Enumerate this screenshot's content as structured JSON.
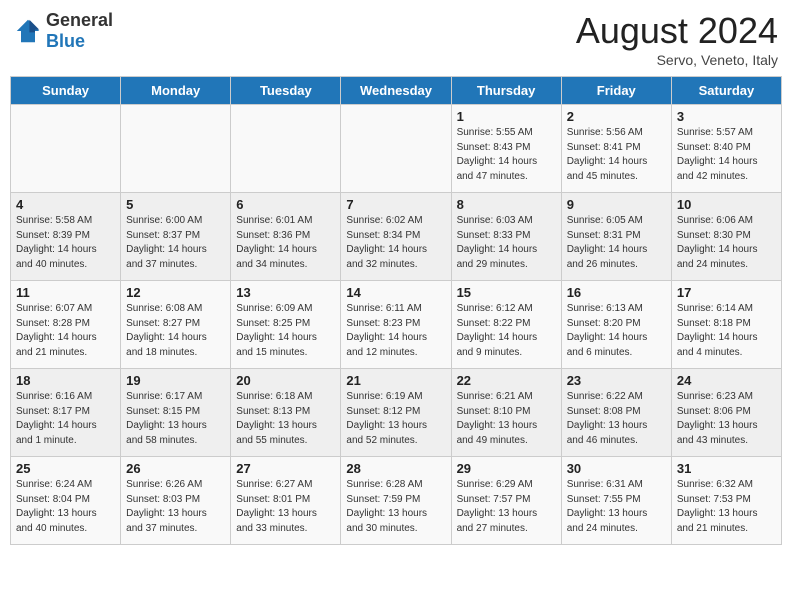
{
  "header": {
    "logo_general": "General",
    "logo_blue": "Blue",
    "month_year": "August 2024",
    "location": "Servo, Veneto, Italy"
  },
  "days_of_week": [
    "Sunday",
    "Monday",
    "Tuesday",
    "Wednesday",
    "Thursday",
    "Friday",
    "Saturday"
  ],
  "weeks": [
    [
      {
        "day": "",
        "info": ""
      },
      {
        "day": "",
        "info": ""
      },
      {
        "day": "",
        "info": ""
      },
      {
        "day": "",
        "info": ""
      },
      {
        "day": "1",
        "info": "Sunrise: 5:55 AM\nSunset: 8:43 PM\nDaylight: 14 hours and 47 minutes."
      },
      {
        "day": "2",
        "info": "Sunrise: 5:56 AM\nSunset: 8:41 PM\nDaylight: 14 hours and 45 minutes."
      },
      {
        "day": "3",
        "info": "Sunrise: 5:57 AM\nSunset: 8:40 PM\nDaylight: 14 hours and 42 minutes."
      }
    ],
    [
      {
        "day": "4",
        "info": "Sunrise: 5:58 AM\nSunset: 8:39 PM\nDaylight: 14 hours and 40 minutes."
      },
      {
        "day": "5",
        "info": "Sunrise: 6:00 AM\nSunset: 8:37 PM\nDaylight: 14 hours and 37 minutes."
      },
      {
        "day": "6",
        "info": "Sunrise: 6:01 AM\nSunset: 8:36 PM\nDaylight: 14 hours and 34 minutes."
      },
      {
        "day": "7",
        "info": "Sunrise: 6:02 AM\nSunset: 8:34 PM\nDaylight: 14 hours and 32 minutes."
      },
      {
        "day": "8",
        "info": "Sunrise: 6:03 AM\nSunset: 8:33 PM\nDaylight: 14 hours and 29 minutes."
      },
      {
        "day": "9",
        "info": "Sunrise: 6:05 AM\nSunset: 8:31 PM\nDaylight: 14 hours and 26 minutes."
      },
      {
        "day": "10",
        "info": "Sunrise: 6:06 AM\nSunset: 8:30 PM\nDaylight: 14 hours and 24 minutes."
      }
    ],
    [
      {
        "day": "11",
        "info": "Sunrise: 6:07 AM\nSunset: 8:28 PM\nDaylight: 14 hours and 21 minutes."
      },
      {
        "day": "12",
        "info": "Sunrise: 6:08 AM\nSunset: 8:27 PM\nDaylight: 14 hours and 18 minutes."
      },
      {
        "day": "13",
        "info": "Sunrise: 6:09 AM\nSunset: 8:25 PM\nDaylight: 14 hours and 15 minutes."
      },
      {
        "day": "14",
        "info": "Sunrise: 6:11 AM\nSunset: 8:23 PM\nDaylight: 14 hours and 12 minutes."
      },
      {
        "day": "15",
        "info": "Sunrise: 6:12 AM\nSunset: 8:22 PM\nDaylight: 14 hours and 9 minutes."
      },
      {
        "day": "16",
        "info": "Sunrise: 6:13 AM\nSunset: 8:20 PM\nDaylight: 14 hours and 6 minutes."
      },
      {
        "day": "17",
        "info": "Sunrise: 6:14 AM\nSunset: 8:18 PM\nDaylight: 14 hours and 4 minutes."
      }
    ],
    [
      {
        "day": "18",
        "info": "Sunrise: 6:16 AM\nSunset: 8:17 PM\nDaylight: 14 hours and 1 minute."
      },
      {
        "day": "19",
        "info": "Sunrise: 6:17 AM\nSunset: 8:15 PM\nDaylight: 13 hours and 58 minutes."
      },
      {
        "day": "20",
        "info": "Sunrise: 6:18 AM\nSunset: 8:13 PM\nDaylight: 13 hours and 55 minutes."
      },
      {
        "day": "21",
        "info": "Sunrise: 6:19 AM\nSunset: 8:12 PM\nDaylight: 13 hours and 52 minutes."
      },
      {
        "day": "22",
        "info": "Sunrise: 6:21 AM\nSunset: 8:10 PM\nDaylight: 13 hours and 49 minutes."
      },
      {
        "day": "23",
        "info": "Sunrise: 6:22 AM\nSunset: 8:08 PM\nDaylight: 13 hours and 46 minutes."
      },
      {
        "day": "24",
        "info": "Sunrise: 6:23 AM\nSunset: 8:06 PM\nDaylight: 13 hours and 43 minutes."
      }
    ],
    [
      {
        "day": "25",
        "info": "Sunrise: 6:24 AM\nSunset: 8:04 PM\nDaylight: 13 hours and 40 minutes."
      },
      {
        "day": "26",
        "info": "Sunrise: 6:26 AM\nSunset: 8:03 PM\nDaylight: 13 hours and 37 minutes."
      },
      {
        "day": "27",
        "info": "Sunrise: 6:27 AM\nSunset: 8:01 PM\nDaylight: 13 hours and 33 minutes."
      },
      {
        "day": "28",
        "info": "Sunrise: 6:28 AM\nSunset: 7:59 PM\nDaylight: 13 hours and 30 minutes."
      },
      {
        "day": "29",
        "info": "Sunrise: 6:29 AM\nSunset: 7:57 PM\nDaylight: 13 hours and 27 minutes."
      },
      {
        "day": "30",
        "info": "Sunrise: 6:31 AM\nSunset: 7:55 PM\nDaylight: 13 hours and 24 minutes."
      },
      {
        "day": "31",
        "info": "Sunrise: 6:32 AM\nSunset: 7:53 PM\nDaylight: 13 hours and 21 minutes."
      }
    ]
  ]
}
